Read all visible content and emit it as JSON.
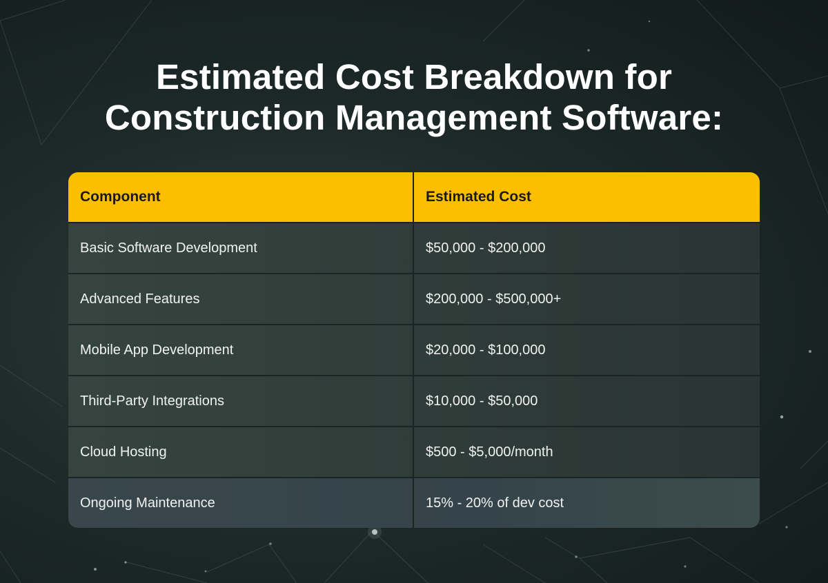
{
  "title": {
    "line1": "Estimated Cost Breakdown for",
    "line2": "Construction Management Software:"
  },
  "table": {
    "headers": [
      "Component",
      "Estimated Cost"
    ],
    "rows": [
      {
        "component": "Basic Software Development",
        "cost": "$50,000 - $200,000"
      },
      {
        "component": "Advanced Features",
        "cost": "$200,000 - $500,000+"
      },
      {
        "component": "Mobile App Development",
        "cost": "$20,000 - $100,000"
      },
      {
        "component": "Third-Party Integrations",
        "cost": "$10,000 - $50,000"
      },
      {
        "component": "Cloud Hosting",
        "cost": "$500 - $5,000/month"
      },
      {
        "component": "Ongoing Maintenance",
        "cost": "15% - 20% of dev cost"
      }
    ]
  },
  "colors": {
    "header_bg": "#fbbf00",
    "header_text": "#1a1a1a",
    "row_text": "#f1f3f2",
    "background": "#1d2a29"
  }
}
